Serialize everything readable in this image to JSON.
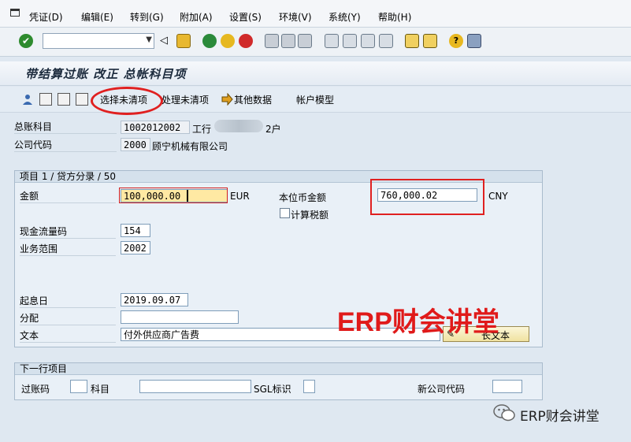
{
  "menu": [
    "凭证(D)",
    "编辑(E)",
    "转到(G)",
    "附加(A)",
    "设置(S)",
    "环境(V)",
    "系统(Y)",
    "帮助(H)"
  ],
  "toolbar_icons": [
    "enter-check-icon",
    "back-icon",
    "save-icon",
    "green-back-icon",
    "yellow-exit-icon",
    "red-cancel-icon",
    "print-icon",
    "find-icon",
    "find-next-icon",
    "first-page-icon",
    "prev-page-icon",
    "next-page-icon",
    "last-page-icon",
    "new-session-icon",
    "shortcut-icon",
    "help-icon",
    "layout-icon"
  ],
  "title": "带结算过账 改正 总帐科目项",
  "app_toolbar": {
    "select_open_items": "选择未清项",
    "process_open_items": "处理未清项",
    "other_data": "其他数据",
    "account_model": "帐户模型"
  },
  "header": {
    "gl_account_label": "总账科目",
    "gl_account_value": "1002012002",
    "gl_account_desc_prefix": "工行",
    "gl_account_desc_suffix": "2户",
    "company_code_label": "公司代码",
    "company_code_value": "2000",
    "company_name": "顾宁机械有限公司"
  },
  "item_group": {
    "title": "项目 1 / 贷方分录 / 50",
    "amount_label": "金额",
    "amount_value": "100,000.00",
    "amount_currency": "EUR",
    "local_amount_label": "本位币金额",
    "local_amount_value": "760,000.02",
    "local_currency": "CNY",
    "calc_tax_label": "计算税额",
    "cash_flow_label": "现金流量码",
    "cash_flow_value": "154",
    "business_area_label": "业务范围",
    "business_area_value": "2002",
    "value_date_label": "起息日",
    "value_date_value": "2019.09.07",
    "assignment_label": "分配",
    "assignment_value": "",
    "text_label": "文本",
    "text_value": "付外供应商广告费",
    "long_text_button": "长文本"
  },
  "next_item_group": {
    "title": "下一行项目",
    "posting_key_label": "过账码",
    "account_label": "科目",
    "sgl_label": "SGL标识",
    "new_company_code_label": "新公司代码"
  },
  "watermark": "ERP财会讲堂",
  "footer_brand": "ERP财会讲堂",
  "colors": {
    "highlight_red": "#e02020",
    "field_yellow": "#ffe9a3"
  }
}
